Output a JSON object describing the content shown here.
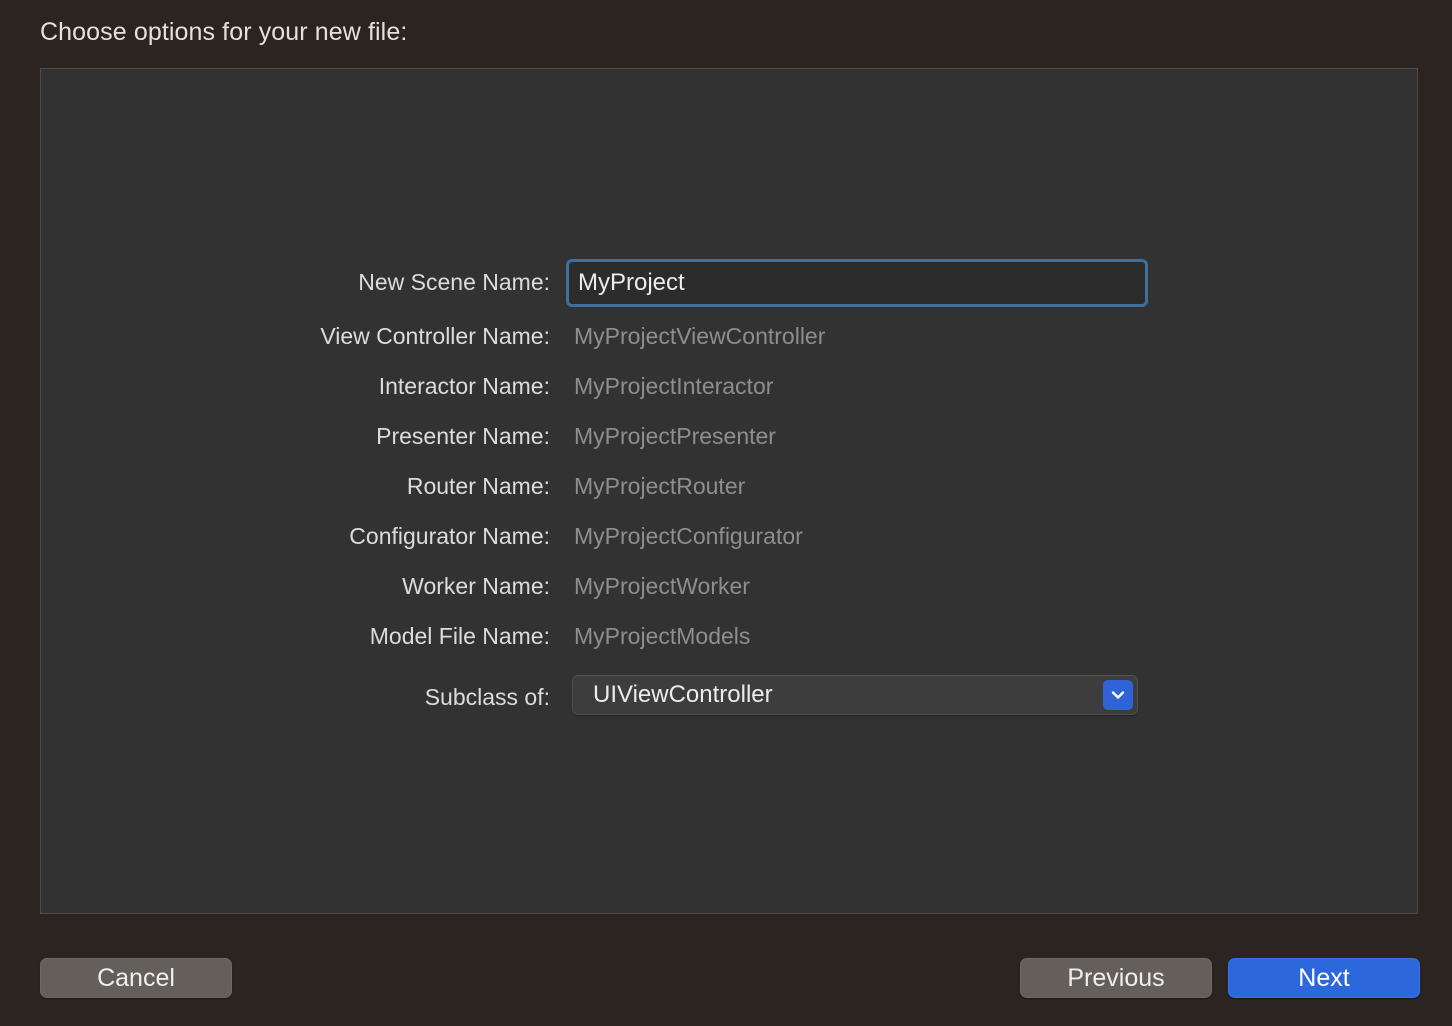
{
  "sheet": {
    "title": "Choose options for your new file:"
  },
  "form": {
    "scene_name": {
      "label": "New Scene Name:",
      "value": "MyProject"
    },
    "fields": [
      {
        "label": "View Controller Name:",
        "value": "MyProjectViewController"
      },
      {
        "label": "Interactor Name:",
        "value": "MyProjectInteractor"
      },
      {
        "label": "Presenter Name:",
        "value": "MyProjectPresenter"
      },
      {
        "label": "Router Name:",
        "value": "MyProjectRouter"
      },
      {
        "label": "Configurator Name:",
        "value": "MyProjectConfigurator"
      },
      {
        "label": "Worker Name:",
        "value": "MyProjectWorker"
      },
      {
        "label": "Model File Name:",
        "value": "MyProjectModels"
      }
    ],
    "subclass": {
      "label": "Subclass of:",
      "selected": "UIViewController",
      "icon": "chevron-down-icon"
    }
  },
  "buttons": {
    "cancel": "Cancel",
    "previous": "Previous",
    "next": "Next"
  },
  "colors": {
    "accent": "#2d67dc",
    "focus_ring": "#3f6f9f",
    "sheet_background": "#2b2420",
    "panel_background": "#323232"
  }
}
